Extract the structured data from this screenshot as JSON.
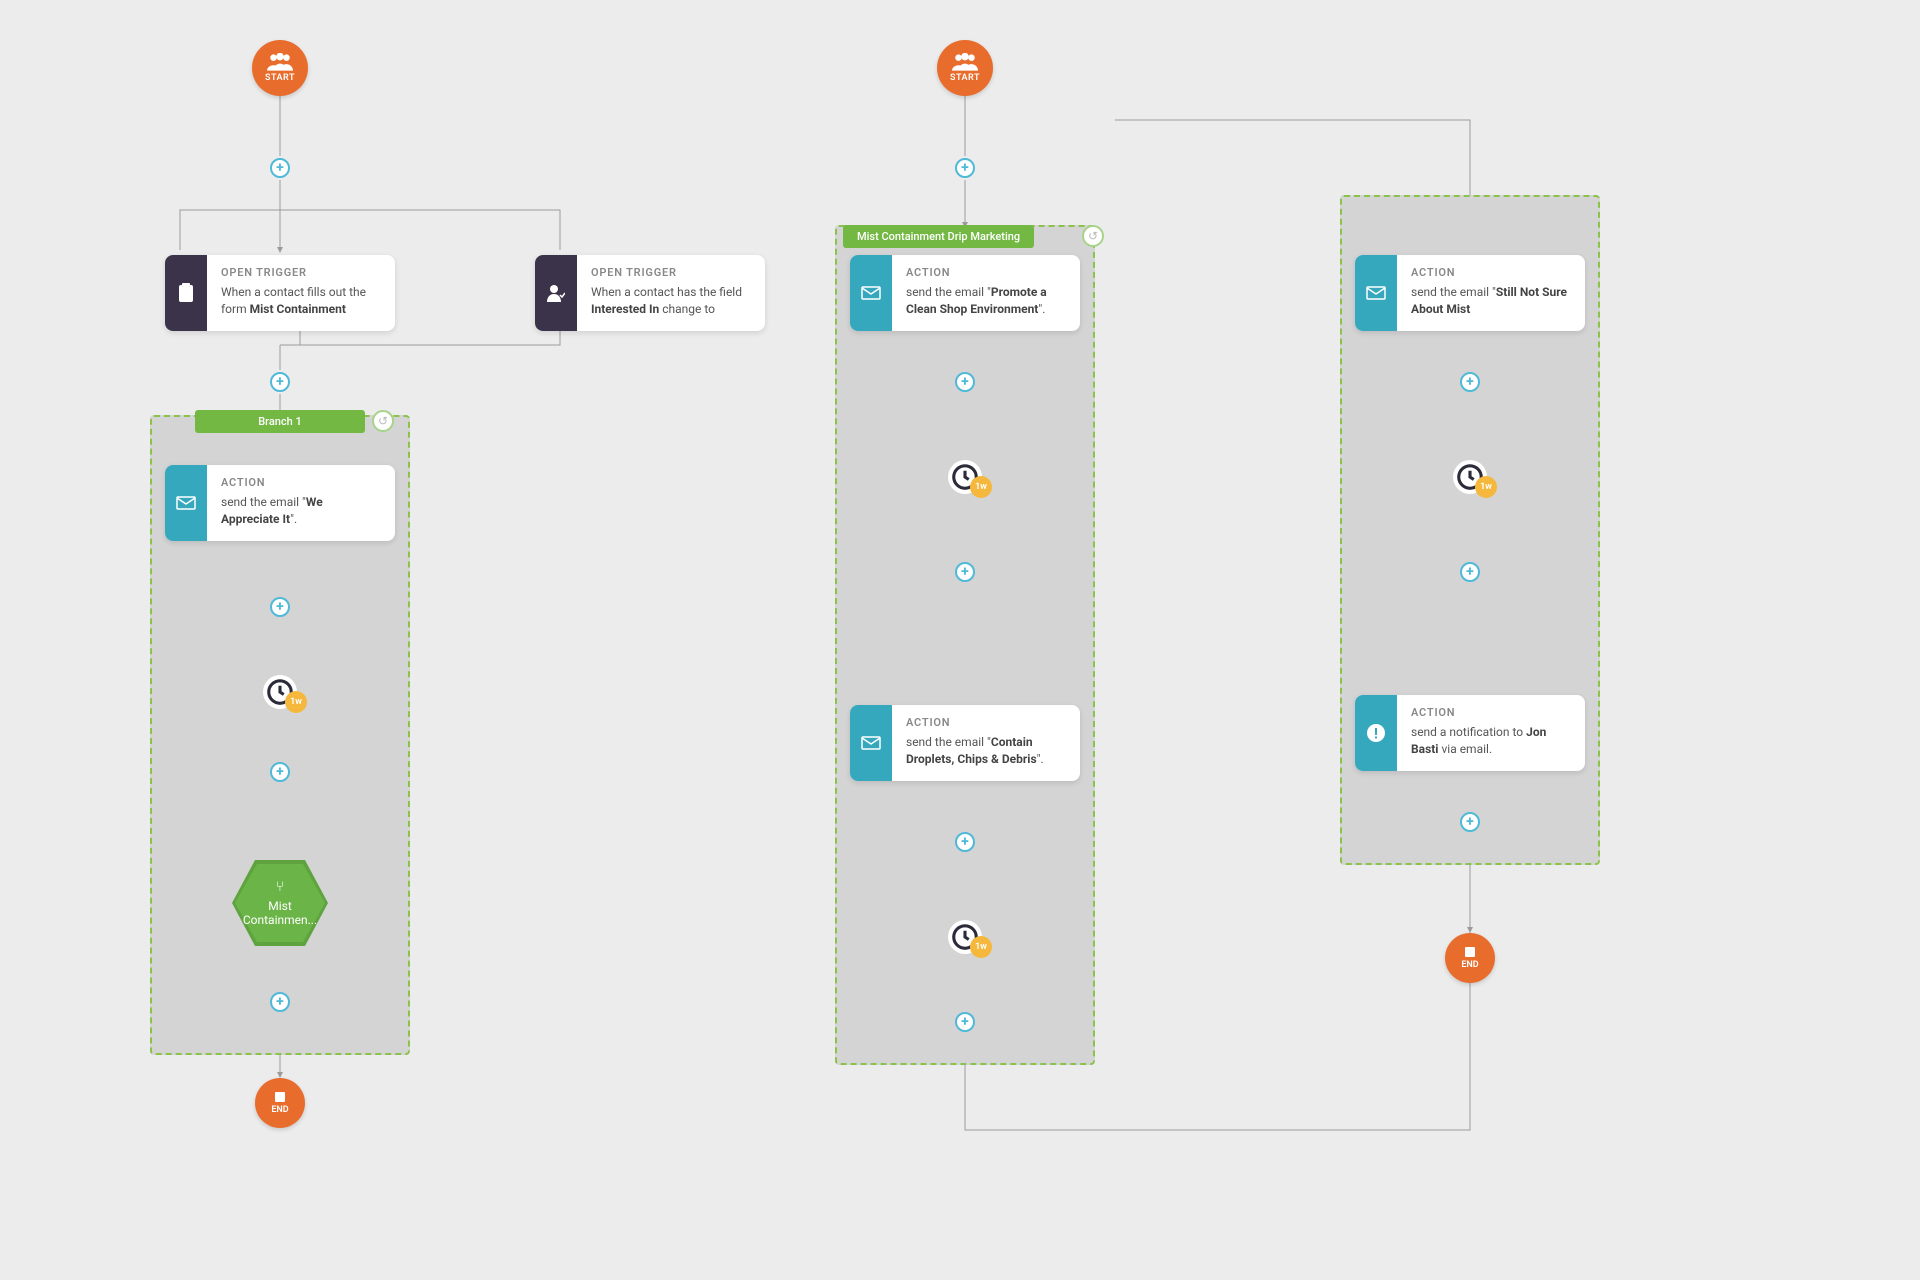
{
  "start_label": "START",
  "end_label": "END",
  "delay_label": "1w",
  "branch1_label": "Branch 1",
  "branch2_label": "Mist Containment Drip Marketing",
  "trigger1": {
    "head": "OPEN TRIGGER",
    "text_pre": "When a contact fills out the form ",
    "text_bold": "Mist Containment"
  },
  "trigger2": {
    "head": "OPEN TRIGGER",
    "text_pre": "When a contact has the field ",
    "text_bold": "Interested In",
    "text_post": " change to"
  },
  "action1": {
    "head": "ACTION",
    "text_pre": "send the email \"",
    "text_bold": "We Appreciate It",
    "text_post": "\"."
  },
  "action2": {
    "head": "ACTION",
    "text_pre": "send the email \"",
    "text_bold": "Promote a Clean Shop Environment",
    "text_post": "\"."
  },
  "action3": {
    "head": "ACTION",
    "text_pre": "send the email \"",
    "text_bold": "Contain Droplets, Chips & Debris",
    "text_post": "\"."
  },
  "action4": {
    "head": "ACTION",
    "text_pre": "send the email \"",
    "text_bold": "Still Not Sure About Mist"
  },
  "action5": {
    "head": "ACTION",
    "text_pre": "send a notification to ",
    "text_bold": "Jon Basti",
    "text_post": " via email."
  },
  "hex_label": "Mist Containmen..."
}
